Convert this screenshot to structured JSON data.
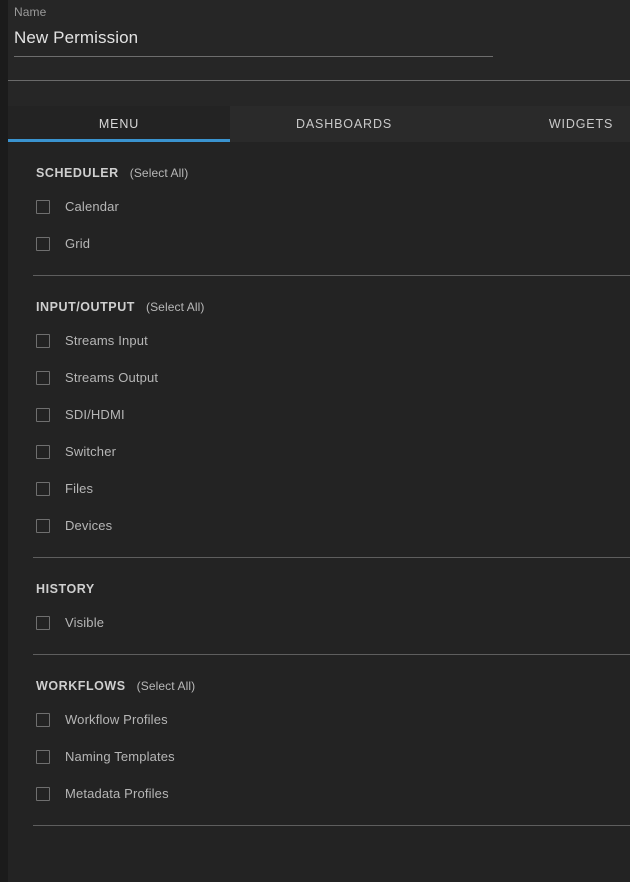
{
  "form": {
    "name_label": "Name",
    "name_value": "New Permission",
    "name_placeholder": "Name"
  },
  "tabs": [
    {
      "label": "MENU",
      "active": true
    },
    {
      "label": "DASHBOARDS",
      "active": false
    },
    {
      "label": "WIDGETS",
      "active": false
    }
  ],
  "colors": {
    "accent": "#3a93cf",
    "panel_bg": "#232323",
    "header_bg": "#262626",
    "tabbar_bg": "#2a2a2a",
    "active_tab_bg": "#232323",
    "divider": "#5e5e5e",
    "text_primary": "#e2e2e2",
    "text_secondary": "#b6b6b6",
    "text_muted": "#9a9a9a",
    "checkbox_border": "#6f6f6f"
  },
  "sections": [
    {
      "title": "SCHEDULER",
      "select_all": "(Select All)",
      "items": [
        {
          "label": "Calendar",
          "checked": false
        },
        {
          "label": "Grid",
          "checked": false
        }
      ]
    },
    {
      "title": "INPUT/OUTPUT",
      "select_all": "(Select All)",
      "items": [
        {
          "label": "Streams Input",
          "checked": false
        },
        {
          "label": "Streams Output",
          "checked": false
        },
        {
          "label": "SDI/HDMI",
          "checked": false
        },
        {
          "label": "Switcher",
          "checked": false
        },
        {
          "label": "Files",
          "checked": false
        },
        {
          "label": "Devices",
          "checked": false
        }
      ]
    },
    {
      "title": "HISTORY",
      "select_all": "",
      "items": [
        {
          "label": "Visible",
          "checked": false
        }
      ]
    },
    {
      "title": "WORKFLOWS",
      "select_all": "(Select All)",
      "items": [
        {
          "label": "Workflow Profiles",
          "checked": false
        },
        {
          "label": "Naming Templates",
          "checked": false
        },
        {
          "label": "Metadata Profiles",
          "checked": false
        }
      ]
    }
  ]
}
